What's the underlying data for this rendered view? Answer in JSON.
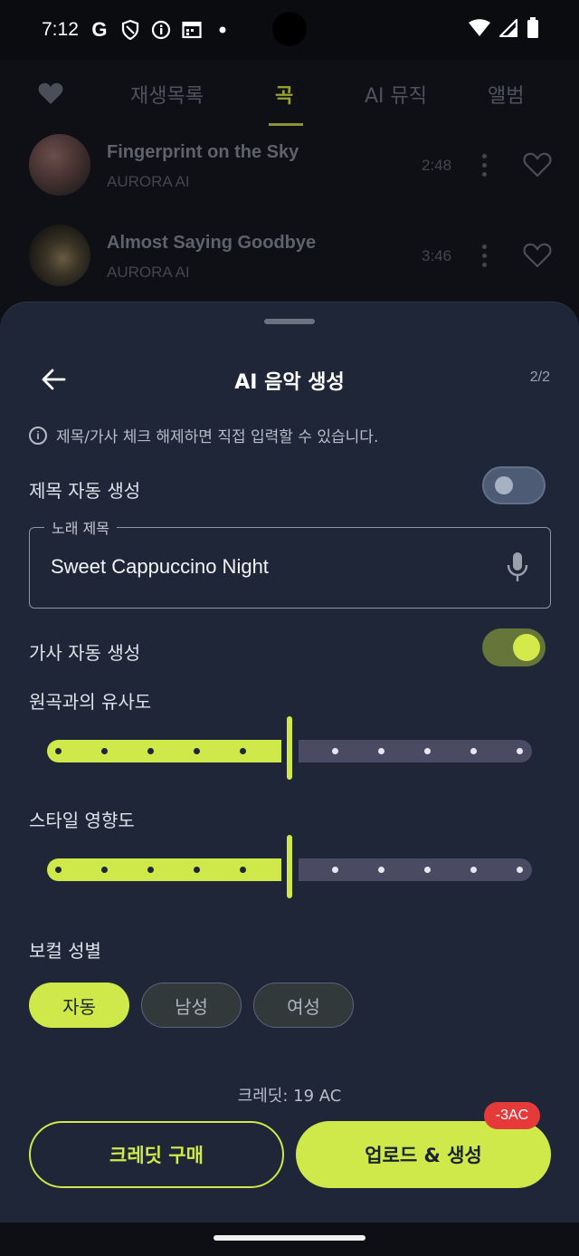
{
  "status_bar": {
    "time": "7:12",
    "left_icons": [
      "google-g-icon",
      "shield-icon",
      "info-icon",
      "calendar-icon",
      "dot-icon"
    ],
    "right_icons": [
      "wifi-icon",
      "signal-icon",
      "battery-icon"
    ]
  },
  "tabs": {
    "items": [
      {
        "label": "재생목록"
      },
      {
        "label": "곡"
      },
      {
        "label": "AI 뮤직"
      },
      {
        "label": "앨범"
      }
    ],
    "active_index": 1
  },
  "songs": [
    {
      "title": "Fingerprint on the Sky",
      "artist": "AURORA AI",
      "duration": "2:48"
    },
    {
      "title": "Almost Saying Goodbye",
      "artist": "AURORA AI",
      "duration": "3:46"
    }
  ],
  "sheet": {
    "title": "AI 음악 생성",
    "step": "2/2",
    "info_text": "제목/가사 체크 해제하면 직접 입력할 수 있습니다.",
    "auto_title_label": "제목 자동 생성",
    "auto_title_on": false,
    "song_title_field": {
      "label": "노래 제목",
      "value": "Sweet Cappuccino Night"
    },
    "auto_lyrics_label": "가사 자동 생성",
    "auto_lyrics_on": true,
    "similarity_label": "원곡과의 유사도",
    "similarity_value": 0.5,
    "style_influence_label": "스타일 영향도",
    "style_influence_value": 0.5,
    "vocal_gender_label": "보컬 성별",
    "vocal_options": [
      "자동",
      "남성",
      "여성"
    ],
    "vocal_selected": "자동",
    "credits_text": "크레딧: 19 AC",
    "buy_credits_label": "크레딧 구매",
    "generate_label": "업로드 & 생성",
    "cost_badge": "-3AC"
  },
  "colors": {
    "accent": "#cfe84a",
    "sheet_bg": "#1e2637",
    "badge_red": "#e63a3a"
  }
}
